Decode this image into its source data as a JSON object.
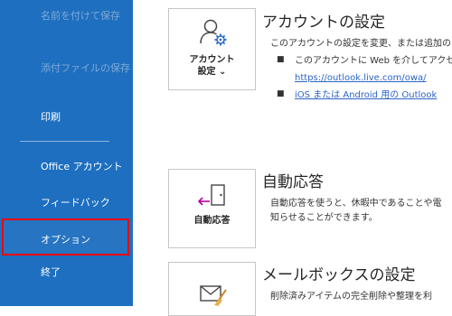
{
  "nav": {
    "items": [
      {
        "label": "名前を付けて保存",
        "enabled": false
      },
      {
        "label": "添付ファイルの保存",
        "enabled": false
      },
      {
        "label": "印刷",
        "enabled": true
      },
      {
        "label": "Office アカウント",
        "enabled": true
      },
      {
        "label": "フィードバック",
        "enabled": true
      },
      {
        "label": "オプション",
        "enabled": true,
        "highlighted": true
      },
      {
        "label": "終了",
        "enabled": true
      }
    ]
  },
  "account": {
    "tile_label": "アカウント設定",
    "tile_label_line1": "アカウント",
    "tile_label_line2": "設定 ⌄",
    "icon": "person-gear-icon",
    "title": "アカウントの設定",
    "desc": "このアカウントの設定を変更、または追加の",
    "bullet1_text": "このアカウントに Web を介してアクセス",
    "bullet1_link": "https://outlook.live.com/owa/",
    "bullet2_link": "iOS または Android 用の Outlook"
  },
  "auto_reply": {
    "tile_label": "自動応答",
    "icon": "door-arrow-icon",
    "title": "自動応答",
    "desc_line1": "自動応答を使うと、休暇中であることや電",
    "desc_line2": "知らせることができます。"
  },
  "mailbox": {
    "icon": "mailbox-broom-icon",
    "title": "メールボックスの設定",
    "desc": "削除済みアイテムの完全削除や整理を利"
  },
  "colors": {
    "nav_bg": "#1e6fc0",
    "nav_disabled_text": "#7fa9d6",
    "highlight_border": "#ff0000",
    "link": "#2b64c6",
    "gear_accent": "#2b6cc4",
    "arrow_accent": "#b4009e"
  }
}
